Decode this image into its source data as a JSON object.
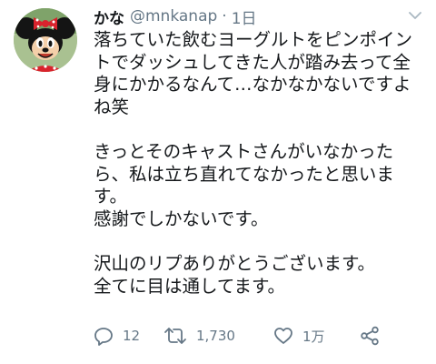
{
  "tweet": {
    "display_name": "かな",
    "username": "@mnkanap",
    "separator": "·",
    "time": "1日",
    "body_lines": [
      "落ちていた飲むヨーグルトをピンポイントでダッシュしてきた人が踏み去って全身にかかるなんて…なかなかないですよね笑",
      "",
      "きっとそのキャストさんがいなかったら、私は立ち直れてなかったと思います。",
      "感謝でしかないです。",
      "",
      "沢山のリプありがとうございます。",
      "全てに目は通してます。"
    ],
    "avatar_icon": "minnie-mouse-avatar-icon",
    "menu_icon": "chevron-down-icon"
  },
  "actions": {
    "reply": {
      "icon": "reply-icon",
      "count": "12"
    },
    "retweet": {
      "icon": "retweet-icon",
      "count": "1,730"
    },
    "like": {
      "icon": "heart-icon",
      "count": "1万"
    },
    "share": {
      "icon": "share-icon"
    }
  },
  "colors": {
    "text_primary": "#14171a",
    "text_secondary": "#657786",
    "background": "#ffffff"
  }
}
